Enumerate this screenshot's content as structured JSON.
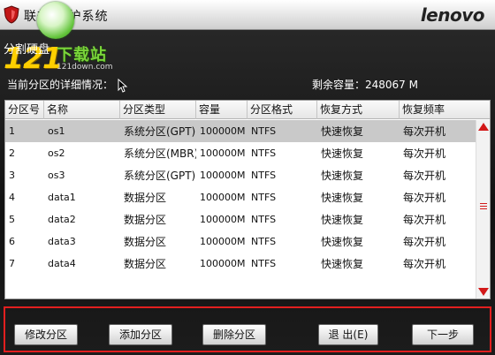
{
  "titlebar": {
    "title": "联想 保护系统",
    "brand": "lenovo"
  },
  "watermark": {
    "number": "121",
    "text": "下载站",
    "url": "121down.com"
  },
  "section_title": "分割硬盘",
  "detail_label": "当前分区的详细情况：",
  "free_space_label": "剩余容量：248067 M",
  "table": {
    "headers": [
      "分区号",
      "名称",
      "分区类型",
      "容量",
      "分区格式",
      "恢复方式",
      "恢复频率"
    ],
    "rows": [
      [
        "1",
        "os1",
        "系统分区(GPT)",
        "100000M",
        "NTFS",
        "快速恢复",
        "每次开机"
      ],
      [
        "2",
        "os2",
        "系统分区(MBR)",
        "100000M",
        "NTFS",
        "快速恢复",
        "每次开机"
      ],
      [
        "3",
        "os3",
        "系统分区(GPT)",
        "100000M",
        "NTFS",
        "快速恢复",
        "每次开机"
      ],
      [
        "4",
        "data1",
        "数据分区",
        "100000M",
        "NTFS",
        "快速恢复",
        "每次开机"
      ],
      [
        "5",
        "data2",
        "数据分区",
        "100000M",
        "NTFS",
        "快速恢复",
        "每次开机"
      ],
      [
        "6",
        "data3",
        "数据分区",
        "100000M",
        "NTFS",
        "快速恢复",
        "每次开机"
      ],
      [
        "7",
        "data4",
        "数据分区",
        "100000M",
        "NTFS",
        "快速恢复",
        "每次开机"
      ]
    ],
    "selected_row": 1
  },
  "buttons": {
    "modify": "修改分区",
    "add": "添加分区",
    "delete": "删除分区",
    "exit": "退 出(E)",
    "next": "下一步"
  },
  "colors": {
    "accent_red": "#e21f1f",
    "selected_row": "#c9c9c9"
  }
}
